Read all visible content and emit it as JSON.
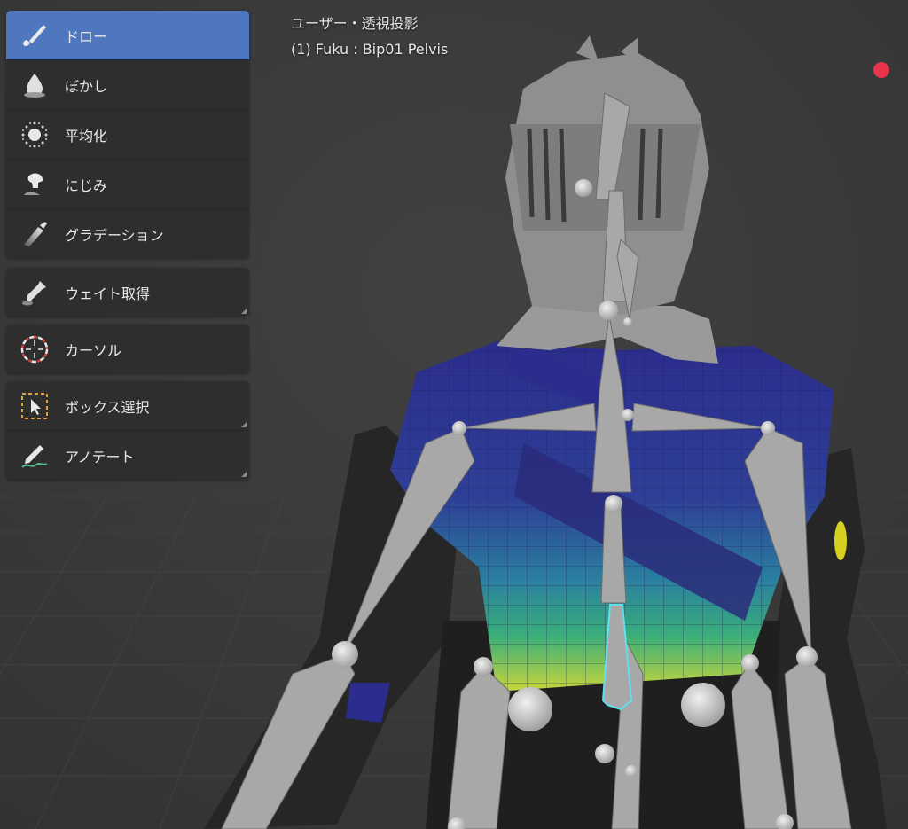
{
  "viewport": {
    "title": "ユーザー・透視投影",
    "active_object": "(1) Fuku : Bip01 Pelvis"
  },
  "toolbar": {
    "groups": [
      {
        "tools": [
          {
            "label": "ドロー",
            "icon": "draw-brush-icon",
            "active": true
          },
          {
            "label": "ぼかし",
            "icon": "blur-drop-icon"
          },
          {
            "label": "平均化",
            "icon": "average-icon"
          },
          {
            "label": "にじみ",
            "icon": "smear-icon"
          },
          {
            "label": "グラデーション",
            "icon": "gradient-icon"
          }
        ]
      },
      {
        "tools": [
          {
            "label": "ウェイト取得",
            "icon": "eyedropper-icon"
          }
        ]
      },
      {
        "tools": [
          {
            "label": "カーソル",
            "icon": "cursor-icon"
          }
        ]
      },
      {
        "tools": [
          {
            "label": "ボックス選択",
            "icon": "box-select-icon"
          },
          {
            "label": "アノテート",
            "icon": "annotate-icon"
          }
        ]
      }
    ]
  },
  "colors": {
    "background": "#3a3a3a",
    "panel": "#2e2e2e",
    "active_tool": "#4f77c0",
    "record": "#e8344a",
    "weight_low": "#2b2c8c",
    "weight_high": "#c8d63a",
    "bone": "#a8a8a8",
    "selected_bone_outline": "#5fe0f0"
  }
}
